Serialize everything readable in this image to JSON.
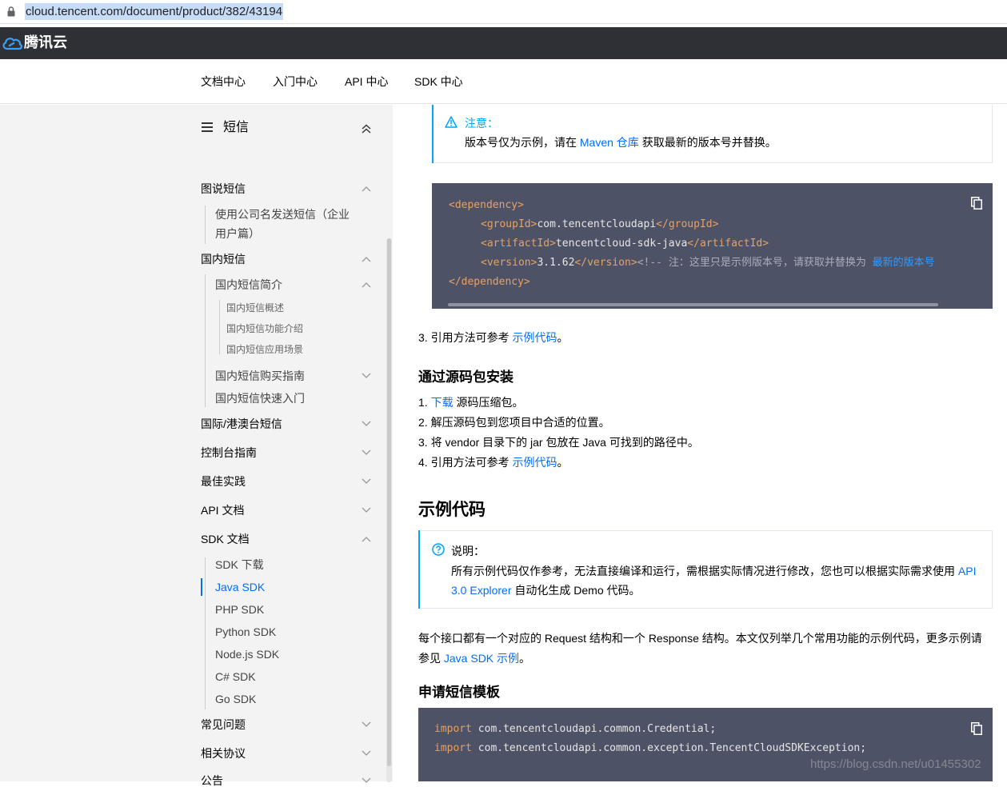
{
  "address_bar": {
    "url": "cloud.tencent.com/document/product/382/43194"
  },
  "header": {
    "logo_text": "腾讯云"
  },
  "docnav": {
    "items": [
      "文档中心",
      "入门中心",
      "API 中心",
      "SDK 中心"
    ]
  },
  "sidebar": {
    "title": "短信",
    "items": [
      {
        "label": "图说短信"
      },
      {
        "label_line1": "使用公司名发送短信（企业",
        "label_line2": "用户篇）"
      },
      {
        "label": "国内短信"
      },
      {
        "label": "国内短信简介"
      },
      {
        "label": "国内短信概述"
      },
      {
        "label": "国内短信功能介绍"
      },
      {
        "label": "国内短信应用场景"
      },
      {
        "label": "国内短信购买指南"
      },
      {
        "label": "国内短信快速入门"
      },
      {
        "label": "国际/港澳台短信"
      },
      {
        "label": "控制台指南"
      },
      {
        "label": "最佳实践"
      },
      {
        "label": "API 文档"
      },
      {
        "label": "SDK 文档"
      },
      {
        "label": "SDK 下载"
      },
      {
        "label": "Java SDK"
      },
      {
        "label": "PHP SDK"
      },
      {
        "label": "Python SDK"
      },
      {
        "label": "Node.js SDK"
      },
      {
        "label": "C# SDK"
      },
      {
        "label": "Go SDK"
      },
      {
        "label": "常见问题"
      },
      {
        "label": "相关协议"
      },
      {
        "label": "公告"
      }
    ]
  },
  "main": {
    "notice1": {
      "title": "注意：",
      "text_before": "版本号仅为示例，请在 ",
      "link": "Maven 仓库",
      "text_after": " 获取最新的版本号并替换。"
    },
    "code1": {
      "dependency_open": "<dependency>",
      "groupId_open": "<groupId>",
      "groupId_value": "com.tencentcloudapi",
      "groupId_close": "</groupId>",
      "artifactId_open": "<artifactId>",
      "artifactId_value": "tencentcloud-sdk-java",
      "artifactId_close": "</artifactId>",
      "version_open": "<version>",
      "version_value": "3.1.62",
      "version_close": "</version>",
      "comment": "<!-- 注：这里只是示例版本号，请获取并替换为",
      "comment_link": "最新的版本号",
      "dependency_close": "</dependency>"
    },
    "step3": {
      "text": "3. 引用方法可参考 ",
      "link": "示例代码",
      "end": "。"
    },
    "source_install": {
      "heading": "通过源码包安装",
      "step1_num": "1. ",
      "step1_link": "下载",
      "step1_text": " 源码压缩包。",
      "step2": "2. 解压源码包到您项目中合适的位置。",
      "step3": "3. 将 vendor 目录下的 jar 包放在 Java 可找到的路径中。",
      "step4_text": "4. 引用方法可参考 ",
      "step4_link": "示例代码",
      "step4_end": "。"
    },
    "example_heading": "示例代码",
    "notice2": {
      "title": "说明：",
      "line1_text": "所有示例代码仅作参考，无法直接编译和运行，需根据实际情况进行修改，您也可以根据实际需求使用 ",
      "line1_link": "API",
      "line2_link": "3.0 Explorer",
      "line2_text": " 自动化生成 Demo 代码。"
    },
    "para": {
      "line1": "每个接口都有一个对应的 Request 结构和一个 Response 结构。本文仅列举几个常用功能的示例代码，更多示例请",
      "line2_text": "参见 ",
      "line2_link": "Java SDK 示例",
      "line2_end": "。"
    },
    "template_heading": "申请短信模板",
    "code2": {
      "kw": "import",
      "line1": " com.tencentcloudapi.common.Credential;",
      "line2": " com.tencentcloudapi.common.exception.TencentCloudSDKException;"
    }
  },
  "watermark": "https://blog.csdn.net/u01455302",
  "colors": {
    "link": "#006eff",
    "notice_accent": "#00a4ff",
    "code_bg": "#4e5266",
    "topbar": "#2e3036",
    "sidebar_bg": "#f3f3f3"
  }
}
